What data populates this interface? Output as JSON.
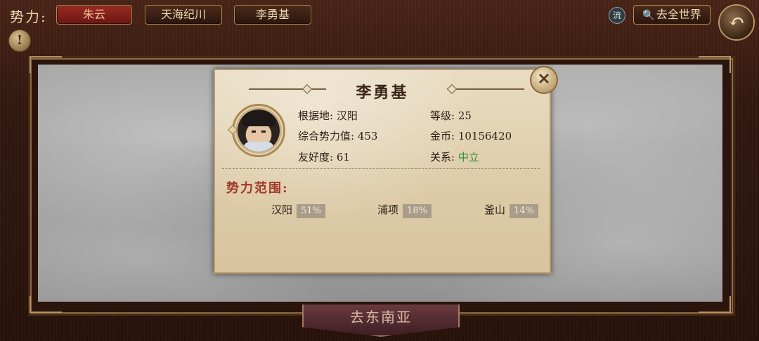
{
  "topbar": {
    "faction_label": "势力:",
    "tabs": [
      {
        "label": "朱云",
        "active": true
      },
      {
        "label": "天海纪川",
        "active": false
      },
      {
        "label": "李勇基",
        "active": false
      }
    ],
    "flow_label": "流",
    "world_button": "去全世界",
    "alert_symbol": "!"
  },
  "panel": {
    "title": "李勇基",
    "close_symbol": "✕",
    "base_label": "根据地:",
    "base_value": "汉阳",
    "level_label": "等级:",
    "level_value": "25",
    "power_label": "综合势力值:",
    "power_value": "453",
    "gold_label": "金币:",
    "gold_value": "10156420",
    "friendship_label": "友好度:",
    "friendship_value": "61",
    "relation_label": "关系:",
    "relation_value": "中立",
    "range_title": "势力范围:",
    "territories": [
      {
        "name": "汉阳",
        "percent": "51%"
      },
      {
        "name": "浦项",
        "percent": "18%"
      },
      {
        "name": "釜山",
        "percent": "14%"
      }
    ]
  },
  "bottom_button": "去东南亚",
  "colors": {
    "relation_neutral": "#2a8a3a",
    "range_title": "#a0382a",
    "active_tab": "#9a2b22"
  }
}
